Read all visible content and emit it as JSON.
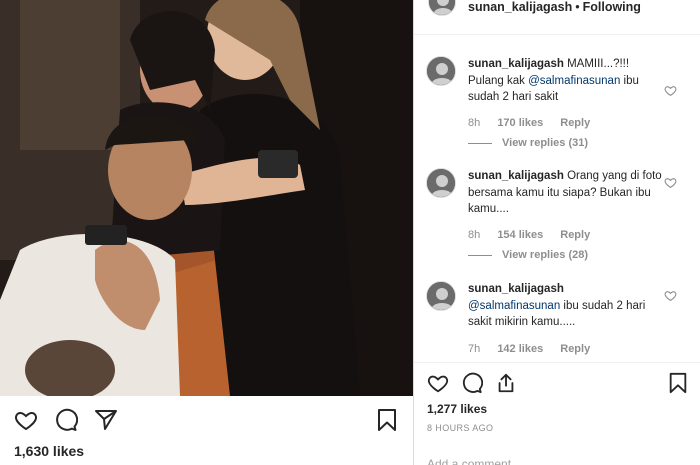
{
  "post": {
    "likes_text": "1,630 likes"
  },
  "header": {
    "username": "sunan_kalijagash",
    "separator": "•",
    "follow_status": "Following"
  },
  "comments": [
    {
      "username": "sunan_kalijagash",
      "text_before": "MAMIII...?!!! Pulang kak ",
      "mention": "@salmafinasunan",
      "text_after": " ibu sudah 2 hari sakit",
      "time": "8h",
      "likes": "170 likes",
      "reply": "Reply",
      "view_replies": "View replies (31)"
    },
    {
      "username": "sunan_kalijagash",
      "text_before": "Orang yang di foto bersama kamu itu siapa? Bukan ibu kamu....",
      "mention": "",
      "text_after": "",
      "time": "8h",
      "likes": "154 likes",
      "reply": "Reply",
      "view_replies": "View replies (28)"
    },
    {
      "username": "sunan_kalijagash",
      "text_before": "",
      "mention": "@salmafinasunan",
      "text_after": " ibu sudah 2 hari sakit mikirin kamu.....",
      "time": "7h",
      "likes": "142 likes",
      "reply": "Reply",
      "view_replies": ""
    }
  ],
  "footer": {
    "likes_text": "1,277 likes",
    "time_text": "8 HOURS AGO",
    "add_comment_placeholder": "Add a comment..."
  },
  "icons": {
    "like": "heart-icon",
    "comment": "comment-icon",
    "share": "share-icon",
    "save": "bookmark-icon"
  },
  "colors": {
    "text": "#262626",
    "muted": "#8e8e8e",
    "mention": "#00376b",
    "divider": "#efefef"
  }
}
